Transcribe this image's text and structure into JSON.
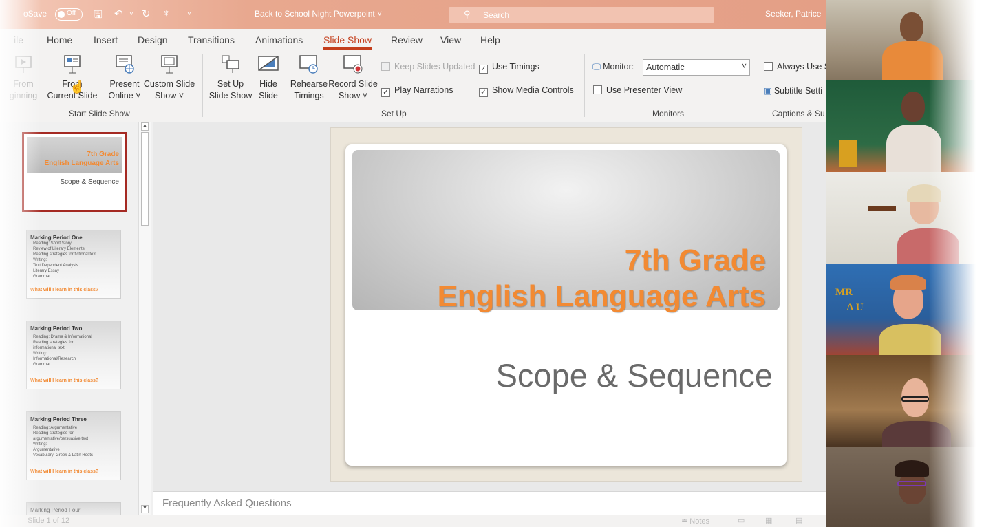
{
  "titlebar": {
    "autosave": "oSave",
    "autosave_state": "Off",
    "doc_title": "Back to School Night Powerpoint",
    "search_placeholder": "Search",
    "user": "Seeker, Patrice"
  },
  "tabs": [
    {
      "label": "ile"
    },
    {
      "label": "Home"
    },
    {
      "label": "Insert"
    },
    {
      "label": "Design"
    },
    {
      "label": "Transitions"
    },
    {
      "label": "Animations"
    },
    {
      "label": "Slide Show",
      "active": true
    },
    {
      "label": "Review"
    },
    {
      "label": "View"
    },
    {
      "label": "Help"
    }
  ],
  "ribbon": {
    "start": {
      "from_beginning": [
        "From",
        "ginning"
      ],
      "from_current": [
        "From",
        "Current Slide"
      ],
      "present_online": [
        "Present",
        "Online ˅"
      ],
      "custom_show": [
        "Custom Slide",
        "Show ˅"
      ],
      "group_label": "Start Slide Show"
    },
    "setup": {
      "setup_show": [
        "Set Up",
        "Slide Show"
      ],
      "hide_slide": [
        "Hide",
        "Slide"
      ],
      "rehearse": [
        "Rehearse",
        "Timings"
      ],
      "record": [
        "Record Slide",
        "Show ˅"
      ],
      "keep_updated": "Keep Slides Updated",
      "play_narrations": "Play Narrations",
      "use_timings": "Use Timings",
      "show_media": "Show Media Controls",
      "group_label": "Set Up"
    },
    "monitors": {
      "monitor_label": "Monitor:",
      "monitor_value": "Automatic",
      "presenter_view": "Use Presenter View",
      "group_label": "Monitors"
    },
    "captions": {
      "always_use": "Always Use S",
      "subtitle_settings": "Subtitle Setti",
      "group_label": "Captions & Su"
    }
  },
  "thumbnails": [
    {
      "title1": "7th Grade",
      "title2": "English Language Arts",
      "sub": "Scope & Sequence"
    },
    {
      "title": "Marking Period One",
      "lines": [
        "Reading: Short Story",
        "Review of Literary Elements",
        "Reading strategies for fictional text",
        "Writing:",
        "Text Dependent Analysis",
        "Literary Essay",
        "Grammar"
      ],
      "footer": "What will I learn in this class?"
    },
    {
      "title": "Marking Period Two",
      "lines": [
        "Reading: Drama & Informational",
        "Reading strategies for",
        "informational text",
        "Writing:",
        "Informational/Research",
        "Grammar"
      ],
      "footer": "What will I learn in this class?"
    },
    {
      "title": "Marking Period Three",
      "lines": [
        "Reading: Argumentative",
        "Reading strategies for",
        "argumentative/persuasive text",
        "Writing:",
        "Argumentative",
        "Vocabulary: Greek & Latin Roots"
      ],
      "footer": "What will I learn in this class?"
    },
    {
      "title": "Marking Period Four"
    }
  ],
  "slide": {
    "title_line1": "7th Grade",
    "title_line2": "English Language Arts",
    "subtitle": "Scope & Sequence"
  },
  "notes_text": "Frequently Asked Questions",
  "status": {
    "slide_info": "Slide 1 of 12",
    "notes": "Notes"
  },
  "colors": {
    "accent": "#c43e1c",
    "slide_title": "#f28a33",
    "titlebar": "#e49f86"
  }
}
